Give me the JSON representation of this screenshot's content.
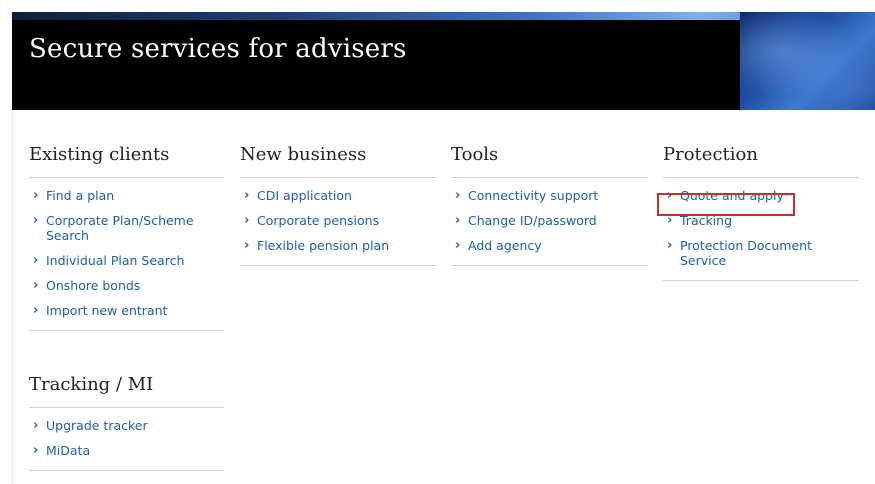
{
  "banner": {
    "title": "Secure services for advisers"
  },
  "columns": [
    {
      "heading": "Existing clients",
      "links": [
        {
          "label": "Find a plan"
        },
        {
          "label": "Corporate Plan/Scheme Search"
        },
        {
          "label": "Individual Plan Search"
        },
        {
          "label": "Onshore bonds"
        },
        {
          "label": "Import new entrant"
        }
      ]
    },
    {
      "heading": "New business",
      "links": [
        {
          "label": "CDI application"
        },
        {
          "label": "Corporate pensions"
        },
        {
          "label": "Flexible pension plan"
        }
      ]
    },
    {
      "heading": "Tools",
      "links": [
        {
          "label": "Connectivity support"
        },
        {
          "label": "Change ID/password"
        },
        {
          "label": "Add agency"
        }
      ]
    },
    {
      "heading": "Protection",
      "links": [
        {
          "label": "Quote and apply"
        },
        {
          "label": "Tracking"
        },
        {
          "label": "Protection Document Service"
        }
      ]
    }
  ],
  "tracking": {
    "heading": "Tracking / MI",
    "links": [
      {
        "label": "Upgrade tracker"
      },
      {
        "label": "MiData"
      }
    ]
  },
  "icons": {
    "link_chevron": "chevron-right-icon",
    "chevron_glyph": "›"
  },
  "colors": {
    "link": "#1e5fa8",
    "banner_bg": "#000000",
    "highlight": "#c8302f"
  }
}
